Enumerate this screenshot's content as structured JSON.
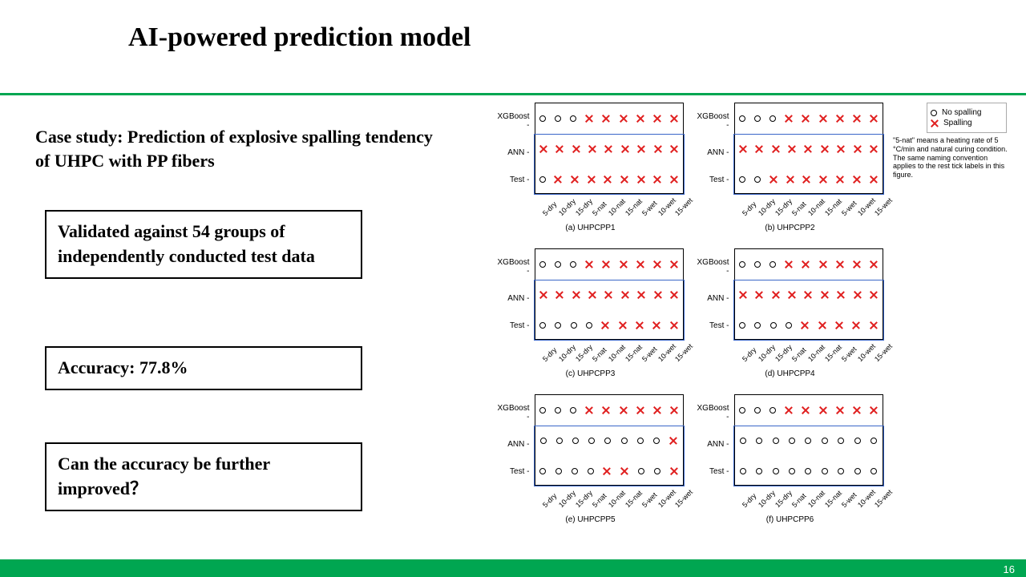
{
  "title": "AI-powered prediction model",
  "subtitle": "Case study: Prediction of explosive spalling tendency of UHPC with PP fibers",
  "boxes": {
    "b1": "Validated against 54 groups of independently conducted test data",
    "b2": "Accuracy: 77.8%",
    "b3": "Can the accuracy be further improved？"
  },
  "page_number": "16",
  "legend": {
    "no_spalling": "No spalling",
    "spalling": "Spalling"
  },
  "note": "\"5-nat\" means a heating rate of 5 °C/min and natural curing condition.\nThe same naming convention applies to the rest tick labels in this figure.",
  "chart_data": {
    "type": "categorical-matrix",
    "y_rows": [
      "XGBoost",
      "ANN",
      "Test"
    ],
    "x_ticks": [
      "5-dry",
      "10-dry",
      "15-dry",
      "5-nat",
      "10-nat",
      "15-nat",
      "5-wet",
      "10-wet",
      "15-wet"
    ],
    "mark_meaning": {
      "o": "No spalling",
      "x": "Spalling"
    },
    "panels": [
      {
        "id": "a",
        "label": "(a) UHPCPP1",
        "XGBoost": [
          "o",
          "o",
          "o",
          "x",
          "x",
          "x",
          "x",
          "x",
          "x"
        ],
        "ANN": [
          "x",
          "x",
          "x",
          "x",
          "x",
          "x",
          "x",
          "x",
          "x"
        ],
        "Test": [
          "o",
          "x",
          "x",
          "x",
          "x",
          "x",
          "x",
          "x",
          "x"
        ]
      },
      {
        "id": "b",
        "label": "(b) UHPCPP2",
        "XGBoost": [
          "o",
          "o",
          "o",
          "x",
          "x",
          "x",
          "x",
          "x",
          "x"
        ],
        "ANN": [
          "x",
          "x",
          "x",
          "x",
          "x",
          "x",
          "x",
          "x",
          "x"
        ],
        "Test": [
          "o",
          "o",
          "x",
          "x",
          "x",
          "x",
          "x",
          "x",
          "x"
        ]
      },
      {
        "id": "c",
        "label": "(c) UHPCPP3",
        "XGBoost": [
          "o",
          "o",
          "o",
          "x",
          "x",
          "x",
          "x",
          "x",
          "x"
        ],
        "ANN": [
          "x",
          "x",
          "x",
          "x",
          "x",
          "x",
          "x",
          "x",
          "x"
        ],
        "Test": [
          "o",
          "o",
          "o",
          "o",
          "x",
          "x",
          "x",
          "x",
          "x"
        ]
      },
      {
        "id": "d",
        "label": "(d) UHPCPP4",
        "XGBoost": [
          "o",
          "o",
          "o",
          "x",
          "x",
          "x",
          "x",
          "x",
          "x"
        ],
        "ANN": [
          "x",
          "x",
          "x",
          "x",
          "x",
          "x",
          "x",
          "x",
          "x"
        ],
        "Test": [
          "o",
          "o",
          "o",
          "o",
          "x",
          "x",
          "x",
          "x",
          "x"
        ]
      },
      {
        "id": "e",
        "label": "(e) UHPCPP5",
        "XGBoost": [
          "o",
          "o",
          "o",
          "x",
          "x",
          "x",
          "x",
          "x",
          "x"
        ],
        "ANN": [
          "o",
          "o",
          "o",
          "o",
          "o",
          "o",
          "o",
          "o",
          "x"
        ],
        "Test": [
          "o",
          "o",
          "o",
          "o",
          "x",
          "x",
          "o",
          "o",
          "x"
        ]
      },
      {
        "id": "f",
        "label": "(f) UHPCPP6",
        "XGBoost": [
          "o",
          "o",
          "o",
          "x",
          "x",
          "x",
          "x",
          "x",
          "x"
        ],
        "ANN": [
          "o",
          "o",
          "o",
          "o",
          "o",
          "o",
          "o",
          "o",
          "o"
        ],
        "Test": [
          "o",
          "o",
          "o",
          "o",
          "o",
          "o",
          "o",
          "o",
          "o"
        ]
      }
    ]
  }
}
